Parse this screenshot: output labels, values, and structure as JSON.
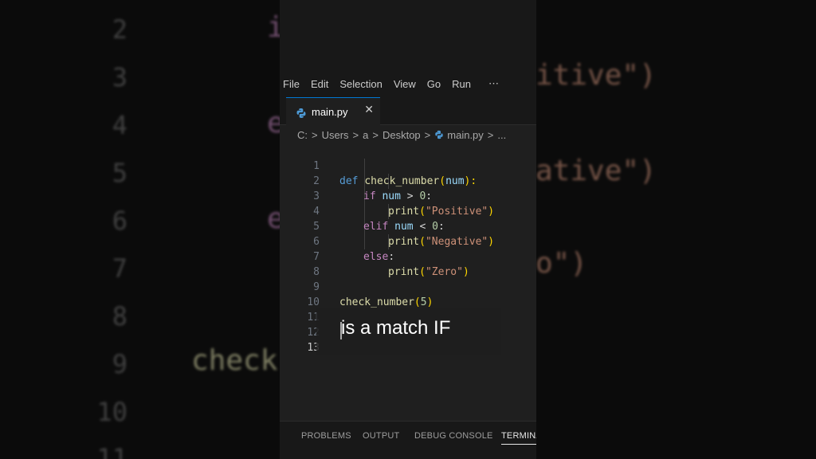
{
  "background": {
    "line_numbers": [
      "2",
      "3",
      "4",
      "5",
      "6",
      "7",
      "8",
      "9",
      "10",
      "11"
    ],
    "fragments": [
      "i",
      "itive\")",
      "e",
      "ative\")",
      "e",
      "o\")",
      "check"
    ]
  },
  "menu": {
    "items": [
      "File",
      "Edit",
      "Selection",
      "View",
      "Go",
      "Run",
      "⋯"
    ]
  },
  "tab": {
    "label": "main.py",
    "close": "✕",
    "icon": "python-file-icon"
  },
  "breadcrumb": [
    "C:",
    ">",
    "Users",
    ">",
    "a",
    ">",
    "Desktop",
    ">",
    "main.py",
    ">",
    "..."
  ],
  "editor": {
    "line_numbers": [
      "1",
      "2",
      "3",
      "4",
      "5",
      "6",
      "7",
      "8",
      "9",
      "10",
      "11",
      "12",
      "13"
    ],
    "lines": {
      "l1": [
        "def",
        " ",
        "check_number",
        "(",
        "num",
        "):"
      ],
      "l2": [
        "if",
        " ",
        "num",
        " > ",
        "0",
        ":"
      ],
      "l3": [
        "print",
        "(",
        "\"Positive\"",
        ")"
      ],
      "l4": [
        "elif",
        " ",
        "num",
        " < ",
        "0",
        ":"
      ],
      "l5": [
        "print",
        "(",
        "\"Negative\"",
        ")"
      ],
      "l6": [
        "else",
        ":"
      ],
      "l7": [
        "print",
        "(",
        "\"Zero\"",
        ")"
      ],
      "l9": [
        "check_number",
        "(",
        "5",
        ")"
      ]
    }
  },
  "caption": "is a match IF",
  "panel_tabs": [
    "PROBLEMS",
    "OUTPUT",
    "DEBUG CONSOLE",
    "TERMINA"
  ],
  "colors": {
    "accent": "#0078d4",
    "keyword": "#569cd6",
    "control": "#c586c0",
    "function": "#dcdcaa",
    "string": "#ce9178"
  }
}
